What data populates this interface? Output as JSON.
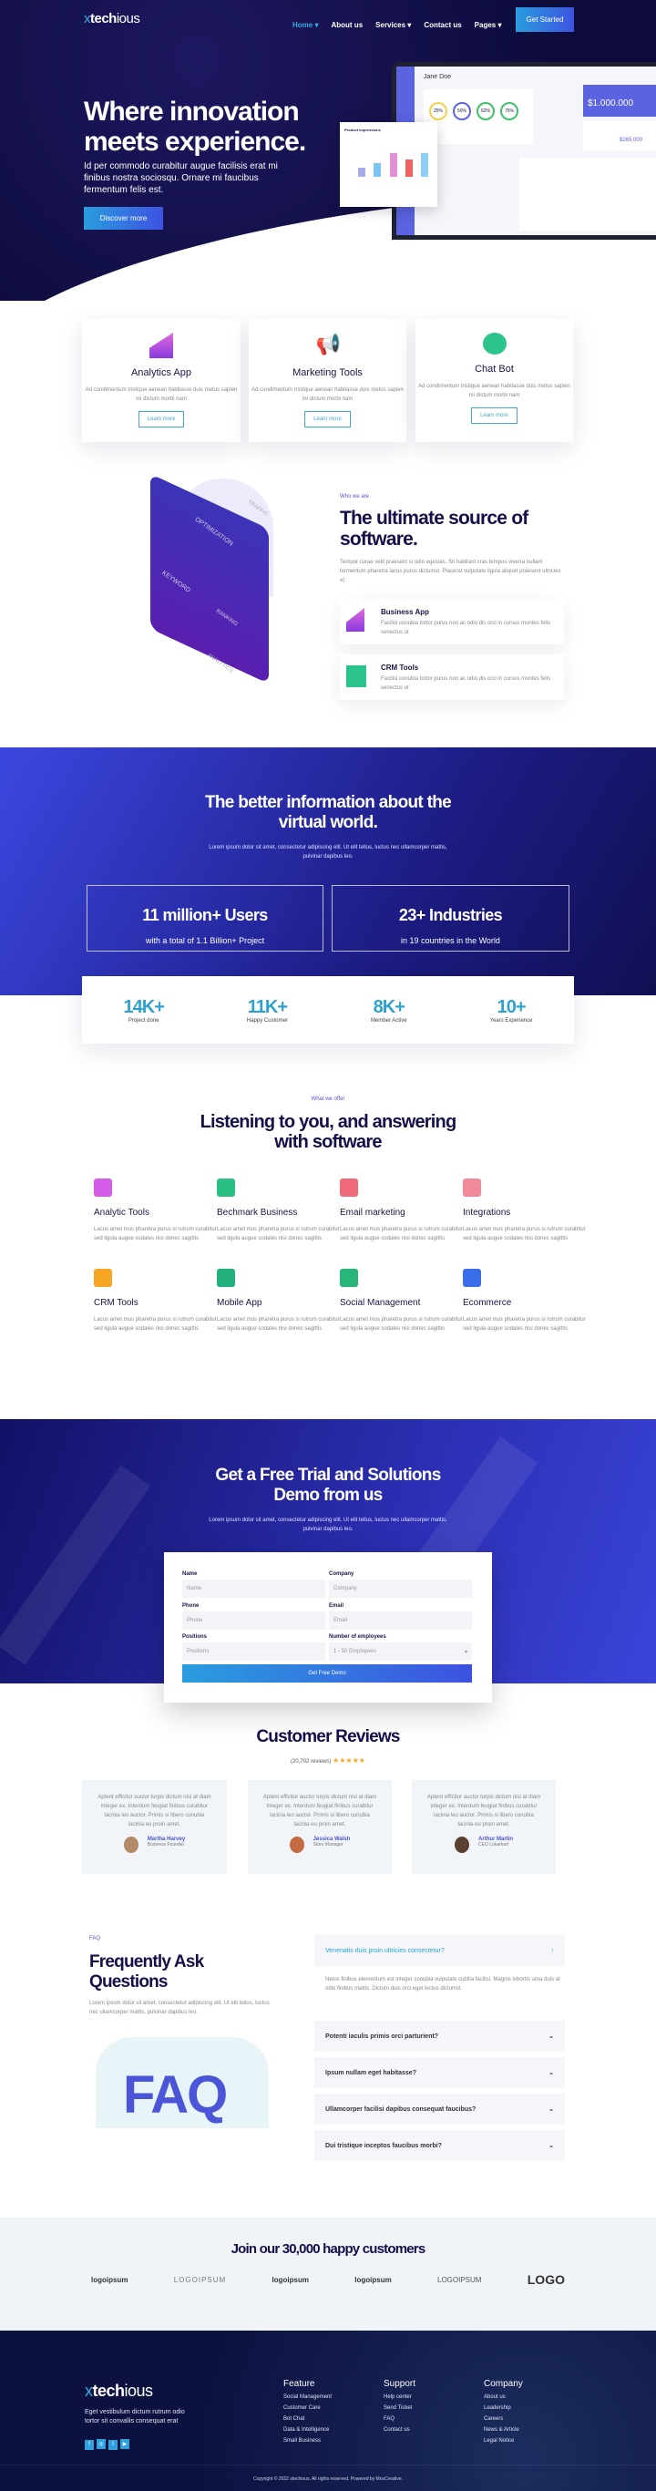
{
  "nav": {
    "logo_prefix": "x",
    "logo_bold": "tech",
    "logo_rest": "ious",
    "items": [
      "Home",
      "About us",
      "Services",
      "Contact us",
      "Pages"
    ],
    "cta": "Get Started"
  },
  "hero": {
    "title_line1": "Where innovation",
    "title_line2": "meets experience.",
    "text": "Id per commodo curabitur augue facilisis erat mi finibus nostra sociosqu. Ornare mi faucibus fermentum felis est.",
    "button": "Discover more",
    "dash_user": "Jane Doe",
    "dash_amount": "$1.000.000",
    "dash_amount2": "$265.000",
    "dash_percents": [
      "25%",
      "50%",
      "62%",
      "75%"
    ],
    "chart_title": "Product Impressions"
  },
  "features": [
    {
      "title": "Analytics App",
      "text": "Ad condimentum tristique aenean habitasse duis metus sapien mi dictum morbi nam",
      "button": "Learn more"
    },
    {
      "title": "Marketing Tools",
      "text": "Ad condimentum tristique aenean habitasse duis metus sapien mi dictum morbi nam",
      "button": "Learn more"
    },
    {
      "title": "Chat Bot",
      "text": "Ad condimentum tristique aenean habitasse duis metus sapien mi dictum morbi nam",
      "button": "Learn more"
    }
  ],
  "about": {
    "eyebrow": "Who we are",
    "title": "The ultimate source of software.",
    "text": "Tempor curae velit praesent si odio egestas. Sit habitant cras tempus viverra nullam fermentum pharetra lacus purus dictumst. Placerat vulputate ligula aliquet praesent ultricies et.",
    "items": [
      {
        "title": "Business App",
        "text": "Facilisi conubia tortor purus non ac odio dis orci in cursus montes felis senectus ut"
      },
      {
        "title": "CRM Tools",
        "text": "Facilisi conubia tortor purus non ac odio dis orci in cursus montes felis senectus ut"
      }
    ],
    "illustration_labels": [
      "OPTIMIZATION",
      "KEYWORD",
      "TRAFFIC",
      "RANKING",
      "ANALYTICS"
    ]
  },
  "info": {
    "title": "The better information about the virtual world.",
    "text": "Lorem ipsum dolor sit amet, consectetur adipiscing elit. Ut elit tellus, luctus nec ullamcorper mattis, pulvinar dapibus leo.",
    "boxes": [
      {
        "big": "11 million+ Users",
        "sub": "with a total of 1.1 Billion+ Project"
      },
      {
        "big": "23+ Industries",
        "sub": "in 19 countries in the World"
      }
    ],
    "stats": [
      {
        "num": "14K+",
        "label": "Project done"
      },
      {
        "num": "11K+",
        "label": "Happy Customer"
      },
      {
        "num": "8K+",
        "label": "Member Active"
      },
      {
        "num": "10+",
        "label": "Years Experience"
      }
    ]
  },
  "offer": {
    "eyebrow": "What we offer",
    "title": "Listening to you, and answering with software",
    "items": [
      {
        "title": "Analytic Tools",
        "text": "Lacus amet mus pharetra purus si rutrum curabitur sed ligula augue sodales nisi donec sagittis",
        "color": "#d45ce8"
      },
      {
        "title": "Bechmark Business",
        "text": "Lacus amet mus pharetra purus si rutrum curabitur sed ligula augue sodales nisi donec sagittis",
        "color": "#2bbf86"
      },
      {
        "title": "Email marketing",
        "text": "Lacus amet mus pharetra purus si rutrum curabitur sed ligula augue sodales nisi donec sagittis",
        "color": "#f06a7a"
      },
      {
        "title": "Integrations",
        "text": "Lacus amet mus pharetra purus si rutrum curabitur sed ligula augue sodales nisi donec sagittis",
        "color": "#f08a9a"
      },
      {
        "title": "CRM Tools",
        "text": "Lacus amet mus pharetra purus si rutrum curabitur sed ligula augue sodales nisi donec sagittis",
        "color": "#f5a623"
      },
      {
        "title": "Mobile App",
        "text": "Lacus amet mus pharetra purus si rutrum curabitur sed ligula augue sodales nisi donec sagittis",
        "color": "#22b07d"
      },
      {
        "title": "Social Management",
        "text": "Lacus amet mus pharetra purus si rutrum curabitur sed ligula augue sodales nisi donec sagittis",
        "color": "#27b57a"
      },
      {
        "title": "Ecommerce",
        "text": "Lacus amet mus pharetra purus si rutrum curabitur sed ligula augue sodales nisi donec sagittis",
        "color": "#3a6ee8"
      }
    ]
  },
  "trial": {
    "title": "Get a Free Trial and Solutions Demo from us",
    "text": "Lorem ipsum dolor sit amet, consectetur adipiscing elit. Ut elit tellus, luctus nec ullamcorper mattis, pulvinar dapibus leo.",
    "fields": [
      {
        "label": "Name",
        "placeholder": "Name"
      },
      {
        "label": "Company",
        "placeholder": "Company"
      },
      {
        "label": "Phone",
        "placeholder": "Phone"
      },
      {
        "label": "Email",
        "placeholder": "Email"
      },
      {
        "label": "Positions",
        "placeholder": "Positions"
      },
      {
        "label": "Number of employees",
        "value": "1 - 50 Employees"
      }
    ],
    "button": "Get Free Demo"
  },
  "reviews": {
    "title": "Customer Reviews",
    "count": "(20,702 reviews)",
    "stars": "★★★★★",
    "rating": 5,
    "items": [
      {
        "text": "Aptent efficitur auctor turpis dictum nisi at diam integer ex. Interdum feugiat finibus curabitur lacinia leo auctor. Primis si libero conubia lacinia eu proin amet.",
        "name": "Martha Harvey",
        "role": "Business Founder"
      },
      {
        "text": "Aptent efficitur auctor turpis dictum nisi at diam integer ex. Interdum feugiat finibus curabitur lacinia leo auctor. Primis si libero conubia lacinia eu proin amet.",
        "name": "Jessica Walsh",
        "role": "Store Manager"
      },
      {
        "text": "Aptent efficitur auctor turpis dictum nisi at diam integer ex. Interdum feugiat finibus curabitur lacinia leo auctor. Primis si libero conubia lacinia eu proin amet.",
        "name": "Arthur Martin",
        "role": "CEO Lokamart"
      }
    ]
  },
  "faq": {
    "eyebrow": "FAQ",
    "title": "Frequently Ask Questions",
    "text": "Lorem ipsum dolor sit amet, consectetur adipiscing elit. Ut elit tellus, luctus nec ullamcorper mattis, pulvinar dapibus leo.",
    "illustration_text": "FAQ",
    "open": {
      "q": "Venenatis duis proin ultricies consectetur?",
      "a": "Netus finibus elementum est integer conubia vulputate cubilia facilisi. Magnis lobortis urna duis at odio finibus mattis. Dictum duis orci eget lectus dictumst."
    },
    "items": [
      "Potenti iaculis primis orci parturient?",
      "Ipsum nullam eget habitasse?",
      "Ullamcorper facilisi dapibus consequat faucibus?",
      "Dui tristique inceptos faucibus morbi?"
    ]
  },
  "clients": {
    "title": "Join our 30,000 happy customers",
    "logos": [
      "logoipsum",
      "LOGOIPSUM",
      "logoipsum",
      "logoipsum",
      "LOGOIPSUM",
      "LOGO"
    ]
  },
  "footer": {
    "text": "Eget vestibulum dictum rutrum odio tortor sit convallis consequat erat",
    "social": [
      "f",
      "◎",
      "t",
      "▶"
    ],
    "cols": [
      {
        "title": "Feature",
        "links": [
          "Social Management",
          "Customer Care",
          "Bot Chat",
          "Data & Intelligence",
          "Small Business"
        ]
      },
      {
        "title": "Support",
        "links": [
          "Help center",
          "Send Ticket",
          "FAQ",
          "Contact us"
        ]
      },
      {
        "title": "Company",
        "links": [
          "About us",
          "Leadership",
          "Careers",
          "News & Article",
          "Legal Notice"
        ]
      }
    ],
    "copyright": "Copyright © 2022 xtechious, All rights reserved. Powered by MoxCreative."
  }
}
